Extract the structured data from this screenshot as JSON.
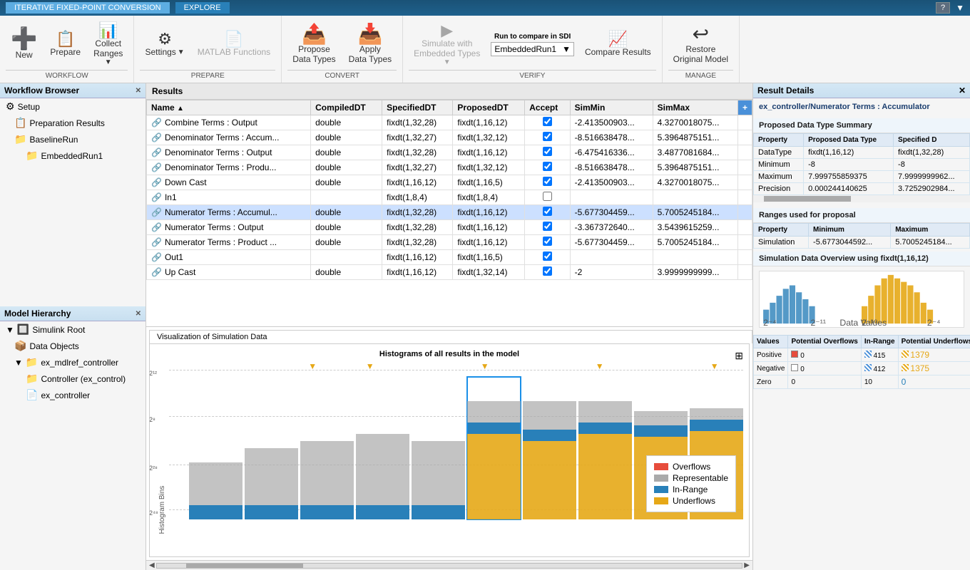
{
  "titleBar": {
    "appName": "ITERATIVE FIXED-POINT CONVERSION",
    "tabs": [
      "ITERATIVE FIXED-POINT CONVERSION",
      "EXPLORE"
    ],
    "activeTab": "ITERATIVE FIXED-POINT CONVERSION",
    "helpLabel": "?"
  },
  "ribbon": {
    "groups": [
      {
        "label": "WORKFLOW",
        "buttons": [
          {
            "id": "new",
            "label": "New",
            "icon": "➕",
            "large": true
          },
          {
            "id": "prepare",
            "label": "Prepare",
            "icon": "📋",
            "large": false
          },
          {
            "id": "collect-ranges",
            "label": "Collect\nRanges",
            "icon": "📊",
            "large": false,
            "dropdown": true
          }
        ]
      },
      {
        "label": "PREPARE",
        "buttons": [
          {
            "id": "settings",
            "label": "Settings",
            "icon": "⚙",
            "dropdown": true
          },
          {
            "id": "matlab-functions",
            "label": "MATLAB Functions",
            "icon": "📄",
            "disabled": true
          }
        ]
      },
      {
        "label": "CONVERT",
        "buttons": [
          {
            "id": "propose-data-types",
            "label": "Propose\nData Types",
            "icon": "📤",
            "large": true
          },
          {
            "id": "apply-data-types",
            "label": "Apply\nData Types",
            "icon": "📥",
            "large": true
          }
        ]
      },
      {
        "label": "VERIFY",
        "buttons": [
          {
            "id": "simulate-embedded",
            "label": "Simulate with\nEmbedded Types",
            "icon": "▶",
            "disabled": true,
            "dropdown": true
          },
          {
            "id": "run-compare",
            "label": "Run to compare in SDI",
            "icon": "",
            "dropdown": true,
            "runLabel": "EmbeddedRun1"
          },
          {
            "id": "compare-results",
            "label": "Compare\nResults",
            "icon": "📈"
          }
        ]
      },
      {
        "label": "MANAGE",
        "buttons": [
          {
            "id": "restore-original",
            "label": "Restore\nOriginal Model",
            "icon": "↩",
            "large": true
          }
        ]
      }
    ]
  },
  "leftPanel": {
    "workflowTitle": "Workflow Browser",
    "workflowItems": [
      {
        "id": "setup",
        "label": "Setup",
        "icon": "⚙",
        "indent": 1
      },
      {
        "id": "preparation-results",
        "label": "Preparation Results",
        "icon": "📋",
        "indent": 1
      },
      {
        "id": "baseline-run",
        "label": "BaselineRun",
        "icon": "📁",
        "indent": 1,
        "selected": false
      },
      {
        "id": "embedded-run",
        "label": "EmbeddedRun1",
        "icon": "📁",
        "indent": 2
      }
    ],
    "modelTitle": "Model Hierarchy",
    "modelItems": [
      {
        "id": "simulink-root",
        "label": "Simulink Root",
        "icon": "🔲",
        "indent": 0
      },
      {
        "id": "data-objects",
        "label": "Data Objects",
        "icon": "📦",
        "indent": 1
      },
      {
        "id": "mdlref-controller",
        "label": "ex_mdlref_controller",
        "icon": "📁",
        "indent": 1
      },
      {
        "id": "controller",
        "label": "Controller (ex_control)",
        "icon": "📁",
        "indent": 2
      },
      {
        "id": "ex-controller",
        "label": "ex_controller",
        "icon": "📄",
        "indent": 2
      }
    ]
  },
  "resultsTable": {
    "sectionTitle": "Results",
    "columns": [
      "Name",
      "CompiledDT",
      "SpecifiedDT",
      "ProposedDT",
      "Accept",
      "SimMin",
      "SimMax"
    ],
    "rows": [
      {
        "name": "Combine Terms : Output",
        "compiledDT": "double",
        "specifiedDT": "fixdt(1,32,28)",
        "proposedDT": "fixdt(1,16,12)",
        "accept": true,
        "simMin": "-2.413500903...",
        "simMax": "4.3270018075...",
        "selected": false
      },
      {
        "name": "Denominator Terms : Accum...",
        "compiledDT": "double",
        "specifiedDT": "fixdt(1,32,27)",
        "proposedDT": "fixdt(1,32,12)",
        "accept": true,
        "simMin": "-8.516638478...",
        "simMax": "5.3964875151...",
        "selected": false
      },
      {
        "name": "Denominator Terms : Output",
        "compiledDT": "double",
        "specifiedDT": "fixdt(1,32,28)",
        "proposedDT": "fixdt(1,16,12)",
        "accept": true,
        "simMin": "-6.475416336...",
        "simMax": "3.4877081684...",
        "selected": false
      },
      {
        "name": "Denominator Terms : Produ...",
        "compiledDT": "double",
        "specifiedDT": "fixdt(1,32,27)",
        "proposedDT": "fixdt(1,32,12)",
        "accept": true,
        "simMin": "-8.516638478...",
        "simMax": "5.3964875151...",
        "selected": false
      },
      {
        "name": "Down Cast",
        "compiledDT": "double",
        "specifiedDT": "fixdt(1,16,12)",
        "proposedDT": "fixdt(1,16,5)",
        "accept": true,
        "simMin": "-2.413500903...",
        "simMax": "4.3270018075...",
        "selected": false
      },
      {
        "name": "In1",
        "compiledDT": "",
        "specifiedDT": "fixdt(1,8,4)",
        "proposedDT": "fixdt(1,8,4)",
        "accept": false,
        "simMin": "",
        "simMax": "",
        "selected": false
      },
      {
        "name": "Numerator Terms : Accumul...",
        "compiledDT": "double",
        "specifiedDT": "fixdt(1,32,28)",
        "proposedDT": "fixdt(1,16,12)",
        "accept": true,
        "simMin": "-5.677304459...",
        "simMax": "5.7005245184...",
        "selected": true
      },
      {
        "name": "Numerator Terms : Output",
        "compiledDT": "double",
        "specifiedDT": "fixdt(1,32,28)",
        "proposedDT": "fixdt(1,16,12)",
        "accept": true,
        "simMin": "-3.367372640...",
        "simMax": "3.5439615259...",
        "selected": false
      },
      {
        "name": "Numerator Terms : Product ...",
        "compiledDT": "double",
        "specifiedDT": "fixdt(1,32,28)",
        "proposedDT": "fixdt(1,16,12)",
        "accept": true,
        "simMin": "-5.677304459...",
        "simMax": "5.7005245184...",
        "selected": false
      },
      {
        "name": "Out1",
        "compiledDT": "",
        "specifiedDT": "fixdt(1,16,12)",
        "proposedDT": "fixdt(1,16,5)",
        "accept": true,
        "simMin": "",
        "simMax": "",
        "selected": false
      },
      {
        "name": "Up Cast",
        "compiledDT": "double",
        "specifiedDT": "fixdt(1,16,12)",
        "proposedDT": "fixdt(1,32,14)",
        "accept": true,
        "simMin": "-2",
        "simMax": "3.9999999999...",
        "selected": false
      }
    ]
  },
  "visualization": {
    "tabLabel": "Visualization of Simulation Data",
    "title": "Histograms of all results in the model",
    "yAxisLabel": "Histogram Bins",
    "xLabels": [
      "2¹²",
      "2⁸",
      "2²⁸",
      "2⁴⁸"
    ],
    "legend": {
      "items": [
        {
          "label": "Overflows",
          "color": "#e74c3c"
        },
        {
          "label": "Representable",
          "color": "#aaaaaa"
        },
        {
          "label": "In-Range",
          "color": "#2980b9"
        },
        {
          "label": "Underflows",
          "color": "#e6a817"
        }
      ]
    }
  },
  "rightPanel": {
    "title": "Result Details",
    "resultTitle": "ex_controller/Numerator Terms : Accumulator",
    "proposedSummaryTitle": "Proposed Data Type Summary",
    "proposedTableHeaders": [
      "Property",
      "Proposed Data Type",
      "Specified D"
    ],
    "proposedRows": [
      {
        "property": "DataType",
        "proposed": "fixdt(1,16,12)",
        "specified": "fixdt(1,32,28)"
      },
      {
        "property": "Minimum",
        "proposed": "-8",
        "specified": "-8"
      },
      {
        "property": "Maximum",
        "proposed": "7.999755859375",
        "specified": "7.9999999962..."
      },
      {
        "property": "Precision",
        "proposed": "0.000244140625",
        "specified": "3.7252902984..."
      }
    ],
    "rangesTitle": "Ranges used for proposal",
    "rangesHeaders": [
      "Property",
      "Minimum",
      "Maximum"
    ],
    "rangesRows": [
      {
        "property": "Simulation",
        "minimum": "-5.6773044592...",
        "maximum": "5.7005245184..."
      }
    ],
    "overviewTitle": "Simulation Data Overview using fixdt(1,16,12)",
    "overviewHeaders": [
      "Values",
      "Potential Overflows",
      "In-Range",
      "Potential Underflows"
    ],
    "overviewRows": [
      {
        "values": "Positive",
        "overflows": "0",
        "inRange": "415",
        "underflows": "1379"
      },
      {
        "values": "Negative",
        "overflows": "0",
        "inRange": "412",
        "underflows": "1375"
      },
      {
        "values": "Zero",
        "overflows": "0",
        "inRange": "10",
        "underflows": "0"
      }
    ]
  },
  "bottomScroll": {
    "leftLabel": "◀",
    "rightLabel": "▶"
  }
}
